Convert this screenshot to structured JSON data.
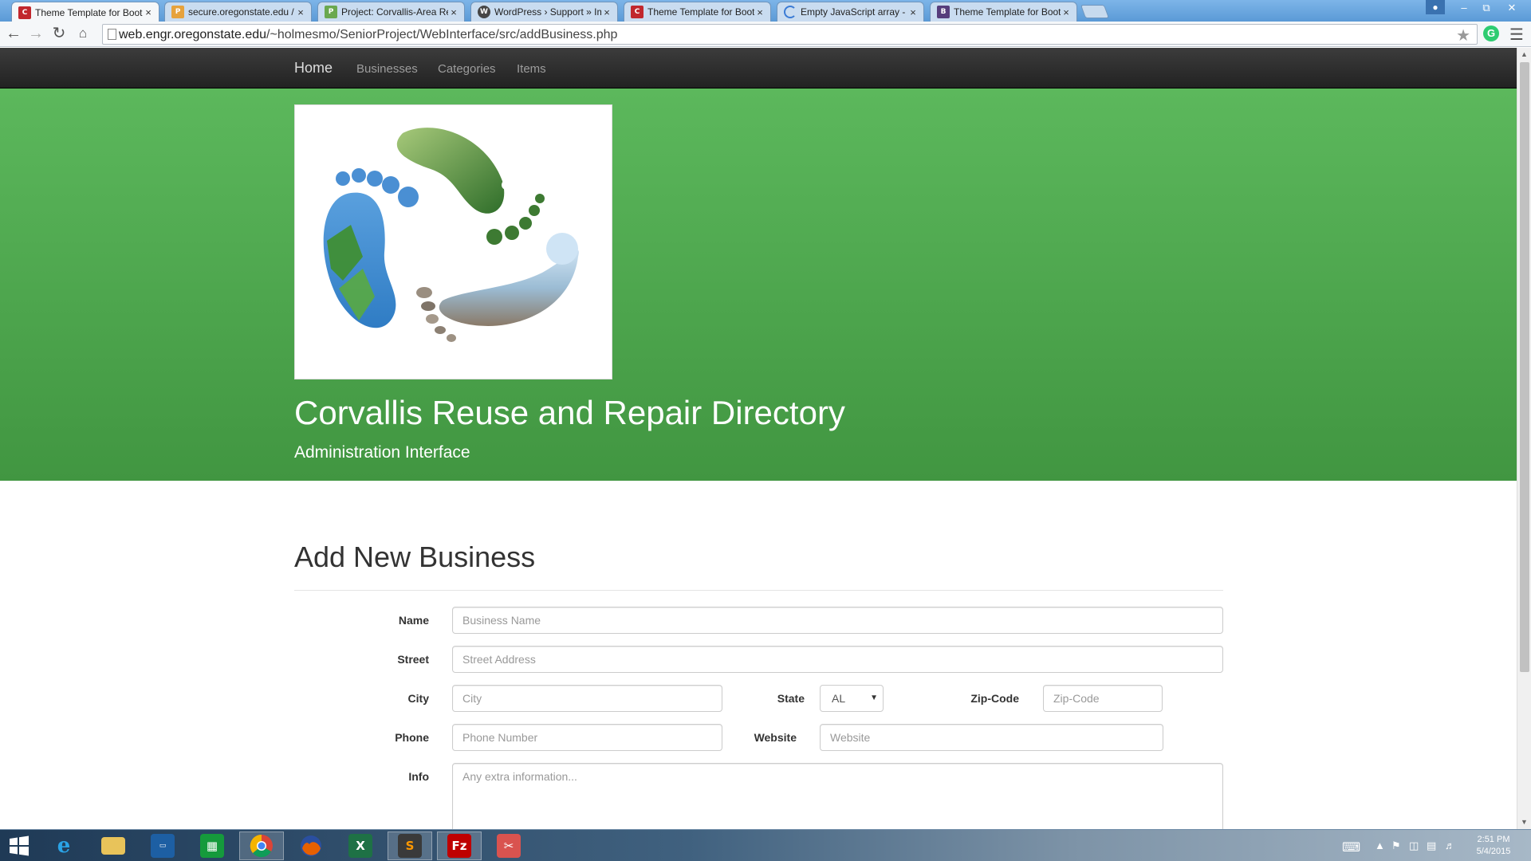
{
  "browser": {
    "tabs": [
      {
        "title": "Theme Template for Boot",
        "favicon": "osu-coe-icon",
        "active": true
      },
      {
        "title": "secure.oregonstate.edu / ",
        "favicon": "phpmyadmin-icon",
        "active": false
      },
      {
        "title": "Project: Corvallis-Area Re",
        "favicon": "project-icon",
        "active": false
      },
      {
        "title": "WordPress › Support » Im",
        "favicon": "wordpress-icon",
        "active": false
      },
      {
        "title": "Theme Template for Boot",
        "favicon": "osu-coe-icon",
        "active": false
      },
      {
        "title": "Empty JavaScript array - js",
        "favicon": "loading-icon",
        "active": false
      },
      {
        "title": "Theme Template for Boot",
        "favicon": "bootstrap-icon",
        "active": false
      }
    ],
    "tab_close": "×",
    "address": {
      "host": "web.engr.oregonstate.edu",
      "path": "/~holmesmo/SeniorProject/WebInterface/src/addBusiness.php"
    }
  },
  "navbar": {
    "brand": "Home",
    "links": [
      "Businesses",
      "Categories",
      "Items"
    ]
  },
  "hero": {
    "title": "Corvallis Reuse and Repair Directory",
    "subtitle": "Administration Interface",
    "logo": "footprints-logo"
  },
  "form": {
    "heading": "Add New Business",
    "fields": {
      "name": {
        "label": "Name",
        "placeholder": "Business Name"
      },
      "street": {
        "label": "Street",
        "placeholder": "Street Address"
      },
      "city": {
        "label": "City",
        "placeholder": "City"
      },
      "state": {
        "label": "State",
        "value": "AL"
      },
      "zip": {
        "label": "Zip-Code",
        "placeholder": "Zip-Code"
      },
      "phone": {
        "label": "Phone",
        "placeholder": "Phone Number"
      },
      "website": {
        "label": "Website",
        "placeholder": "Website"
      },
      "info": {
        "label": "Info",
        "placeholder": "Any extra information..."
      }
    }
  },
  "taskbar": {
    "apps": [
      "start-icon",
      "internet-explorer-icon",
      "file-explorer-icon",
      "lenovo-icon",
      "store-icon",
      "chrome-icon",
      "firefox-icon",
      "excel-icon",
      "sublime-text-icon",
      "filezilla-icon",
      "snipping-tool-icon"
    ],
    "time": "2:51 PM",
    "date": "5/4/2015"
  },
  "colors": {
    "jumbotron_top": "#5cb85c",
    "jumbotron_bottom": "#419641",
    "navbar": "#222222"
  }
}
